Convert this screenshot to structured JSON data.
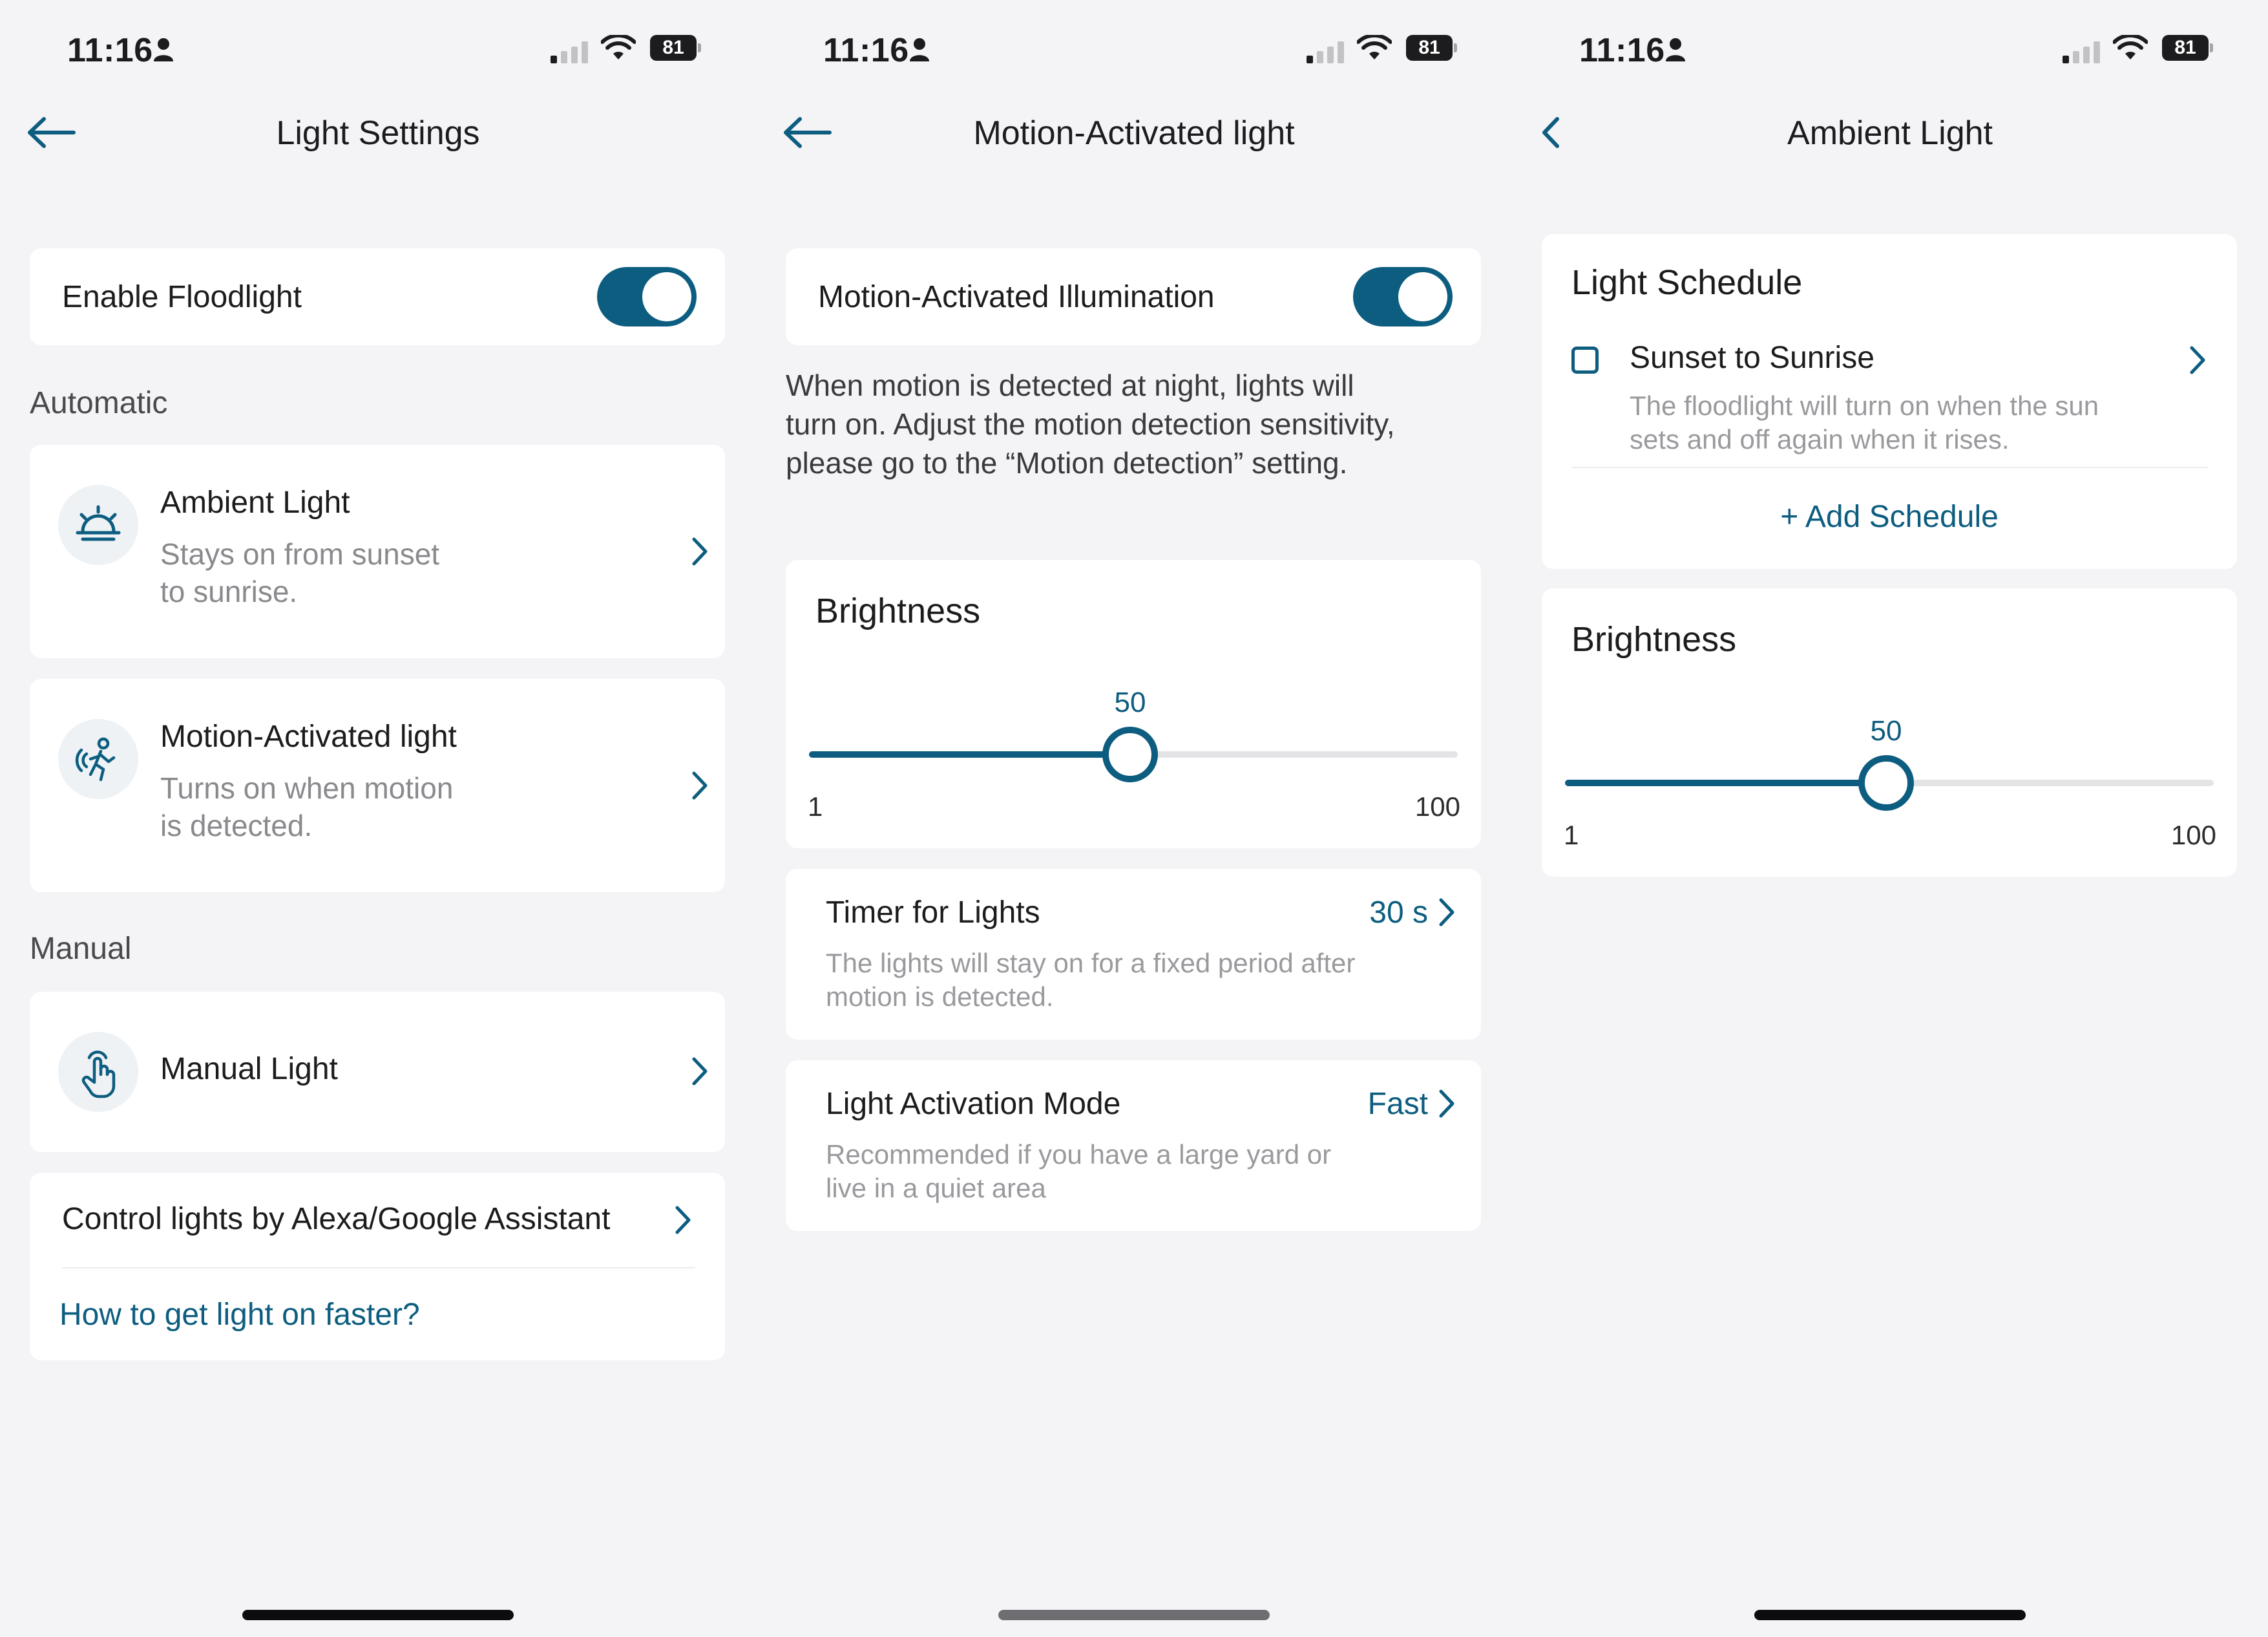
{
  "status": {
    "time": "11:16",
    "battery": "81"
  },
  "screen1": {
    "title": "Light Settings",
    "enable_floodlight": "Enable Floodlight",
    "automatic_label": "Automatic",
    "ambient": {
      "title": "Ambient Light",
      "sub1": "Stays on from sunset",
      "sub2": "to sunrise."
    },
    "motion": {
      "title": "Motion-Activated light",
      "sub1": "Turns on when motion",
      "sub2": "is detected."
    },
    "manual_label": "Manual",
    "manual_light": "Manual Light",
    "alexa": "Control lights by Alexa/Google Assistant",
    "faster_link": "How to get light on faster?"
  },
  "screen2": {
    "title": "Motion-Activated light",
    "illumination": "Motion-Activated Illumination",
    "desc1": "When motion is detected at night, lights will",
    "desc2": "turn on. Adjust the motion detection sensitivity,",
    "desc3": "please go to the “Motion detection” setting.",
    "brightness": {
      "label": "Brightness",
      "value": "50",
      "min": "1",
      "max": "100",
      "fraction": 0.495
    },
    "timer": {
      "title": "Timer for Lights",
      "value": "30 s",
      "sub1": "The lights will stay on for a fixed period after",
      "sub2": "motion is detected."
    },
    "activation": {
      "title": "Light Activation Mode",
      "value": "Fast",
      "sub1": "Recommended if you have a large yard or",
      "sub2": "live in a quiet area"
    }
  },
  "screen3": {
    "title": "Ambient Light",
    "schedule_label": "Light Schedule",
    "sunset": {
      "title": "Sunset to Sunrise",
      "sub1": "The floodlight will turn on when the sun",
      "sub2": "sets and off again when it rises."
    },
    "add_schedule": "+ Add Schedule",
    "brightness": {
      "label": "Brightness",
      "value": "50",
      "min": "1",
      "max": "100",
      "fraction": 0.495
    }
  },
  "colors": {
    "accent": "#0d5d80",
    "background": "#f4f4f6",
    "card": "#ffffff",
    "muted": "#8a8a8e"
  }
}
